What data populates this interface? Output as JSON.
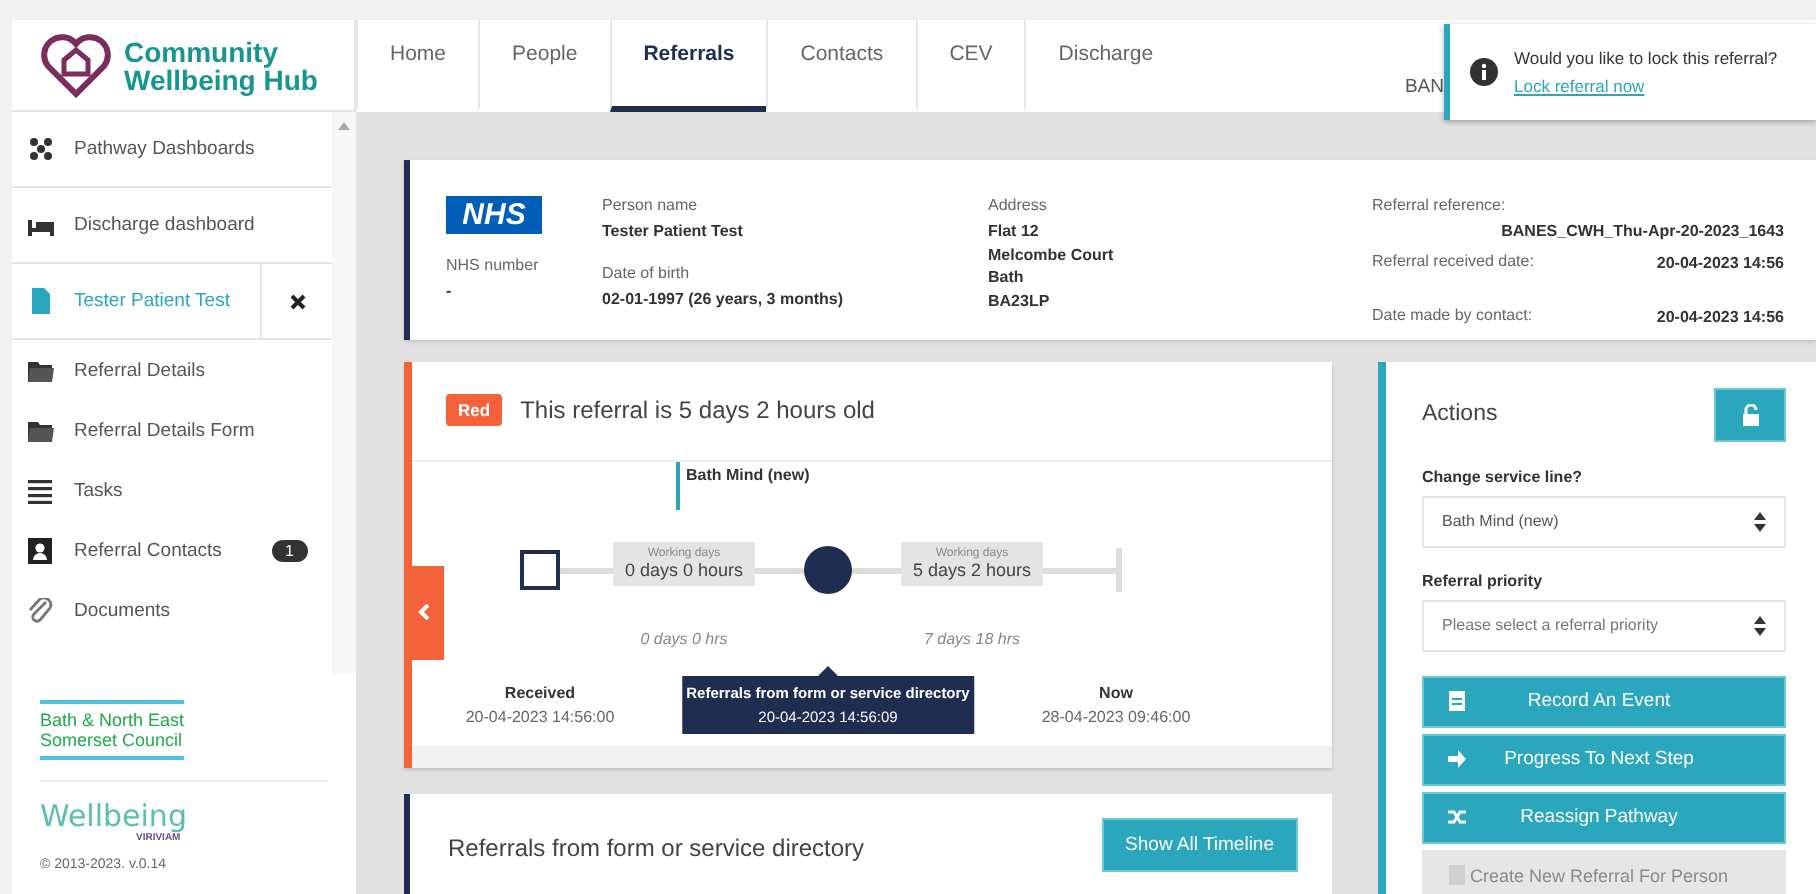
{
  "app": {
    "title": "Community Wellbeing Hub"
  },
  "nav_tabs": [
    {
      "label": "Home",
      "selected": false
    },
    {
      "label": "People",
      "selected": false
    },
    {
      "label": "Referrals",
      "selected": true
    },
    {
      "label": "Contacts",
      "selected": false
    },
    {
      "label": "CEV",
      "selected": false
    },
    {
      "label": "Discharge",
      "selected": false
    }
  ],
  "header_user": "BAN",
  "toast": {
    "message": "Would you like to lock this referral?",
    "link": "Lock referral now"
  },
  "sidebar": {
    "items": [
      {
        "label": "Pathway Dashboards",
        "kind": "dashboard",
        "selected": false
      },
      {
        "label": "Discharge dashboard",
        "kind": "bed",
        "selected": false
      },
      {
        "label": "Tester Patient Test",
        "kind": "patient",
        "selected": true,
        "closable": true
      },
      {
        "label": "Referral Details",
        "kind": "folder",
        "selected": false
      },
      {
        "label": "Referral Details Form",
        "kind": "folder",
        "selected": false
      },
      {
        "label": "Tasks",
        "kind": "list",
        "selected": false
      },
      {
        "label": "Referral Contacts",
        "kind": "contacts",
        "selected": false,
        "badge": "1"
      },
      {
        "label": "Documents",
        "kind": "clip",
        "selected": false
      }
    ]
  },
  "footer": {
    "council": [
      "Bath & North East",
      "Somerset Council"
    ],
    "brand": "Wellbeing",
    "brand_sub": "VIRIVIAM",
    "copyright": "© 2013-2023. v.0.14"
  },
  "patient": {
    "logo": "NHS",
    "nhs_number_label": "NHS number",
    "nhs_number": "-",
    "person": [
      {
        "label": "Person name",
        "value": "Tester Patient Test"
      },
      {
        "label": "Date of birth",
        "value": "02-01-1997 (26 years, 3 months)"
      }
    ],
    "address_label": "Address",
    "address": [
      "Flat 12",
      "Melcombe Court",
      "Bath",
      "BA23LP"
    ],
    "reference_label": "Referral reference:",
    "reference": "BANES_CWH_Thu-Apr-20-2023_1643",
    "dates": [
      {
        "label": "Referral received date:",
        "value": "20-04-2023 14:56"
      },
      {
        "label": "Date made by contact:",
        "value": "20-04-2023 14:56"
      }
    ]
  },
  "timeline": {
    "rag": "Red",
    "title": "This referral is 5 days 2 hours old",
    "service": "Bath Mind (new)",
    "milestones": [
      {
        "kind": "square",
        "label": "Received",
        "time": "20-04-2023 14:56:00",
        "selected": false
      },
      {
        "kind": "circle",
        "label": "Referrals from form or service directory",
        "time": "20-04-2023 14:56:09",
        "selected": true
      },
      {
        "kind": "end",
        "label": "Now",
        "time": "28-04-2023 09:46:00",
        "selected": false
      }
    ],
    "segments": [
      {
        "caption": "Working days",
        "value": "0 days 0 hours",
        "elapsed": "0 days 0 hrs"
      },
      {
        "caption": "Working days",
        "value": "5 days 2 hours",
        "elapsed": "7 days 18 hrs"
      }
    ]
  },
  "history": {
    "title": "Referrals from form or service directory",
    "button": "Show All Timeline"
  },
  "actions": {
    "title": "Actions",
    "fields": [
      {
        "label": "Change service line?",
        "value": "Bath Mind (new)"
      },
      {
        "label": "Referral priority",
        "placeholder": "Please select a referral priority"
      }
    ],
    "buttons": [
      {
        "kind": "event",
        "label": "Record An Event",
        "disabled": false
      },
      {
        "kind": "next",
        "label": "Progress To Next Step",
        "disabled": false
      },
      {
        "kind": "reassign",
        "label": "Reassign Pathway",
        "disabled": false
      },
      {
        "kind": "create",
        "label": "Create New Referral For Person",
        "disabled": true
      }
    ]
  }
}
